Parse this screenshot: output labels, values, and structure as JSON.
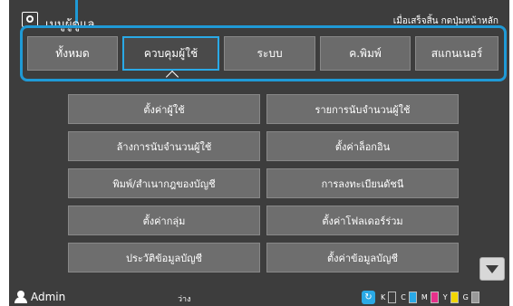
{
  "title_bar": {
    "title": "เมนูผู้ดูแล",
    "hint": "เมื่อเสร็จสิ้น กดปุ่มหน้าหลัก",
    "icon": "admin-settings-icon"
  },
  "tabs": [
    {
      "label": "ทั้งหมด",
      "active": false
    },
    {
      "label": "ควบคุมผู้ใช้",
      "active": true
    },
    {
      "label": "ระบบ",
      "active": false
    },
    {
      "label": "ค.พิมพ์",
      "active": false
    },
    {
      "label": "สแกนเนอร์",
      "active": false
    }
  ],
  "menu_buttons": [
    {
      "label": "ตั้งค่าผู้ใช้"
    },
    {
      "label": "รายการนับจำนวนผู้ใช้"
    },
    {
      "label": "ล้างการนับจำนวนผู้ใช้"
    },
    {
      "label": "ตั้งค่าล็อกอิน"
    },
    {
      "label": "พิมพ์/สำเนากฎของบัญชี"
    },
    {
      "label": "การลงทะเบียนดัชนี"
    },
    {
      "label": "ตั้งค่ากลุ่ม"
    },
    {
      "label": "ตั้งค่าโฟลเดอร์ร่วม"
    },
    {
      "label": "ประวัติข้อมูลบัญชี"
    },
    {
      "label": "ตั้งค่าข้อมูลบัญชี"
    }
  ],
  "status_bar": {
    "user": "Admin",
    "status": "ว่าง",
    "inks": [
      {
        "letter": "K",
        "color": "#3d3d3d",
        "level": 0
      },
      {
        "letter": "C",
        "color": "#2aa9e6",
        "level": 1
      },
      {
        "letter": "M",
        "color": "#e6318b",
        "level": 1
      },
      {
        "letter": "Y",
        "color": "#f2d600",
        "level": 1
      },
      {
        "letter": "G",
        "color": "#9a9a9a",
        "level": 1
      }
    ]
  },
  "colors": {
    "background": "#3d3d3d",
    "highlight": "#1f9ad6",
    "active_tab_border": "#2aa9e6"
  }
}
